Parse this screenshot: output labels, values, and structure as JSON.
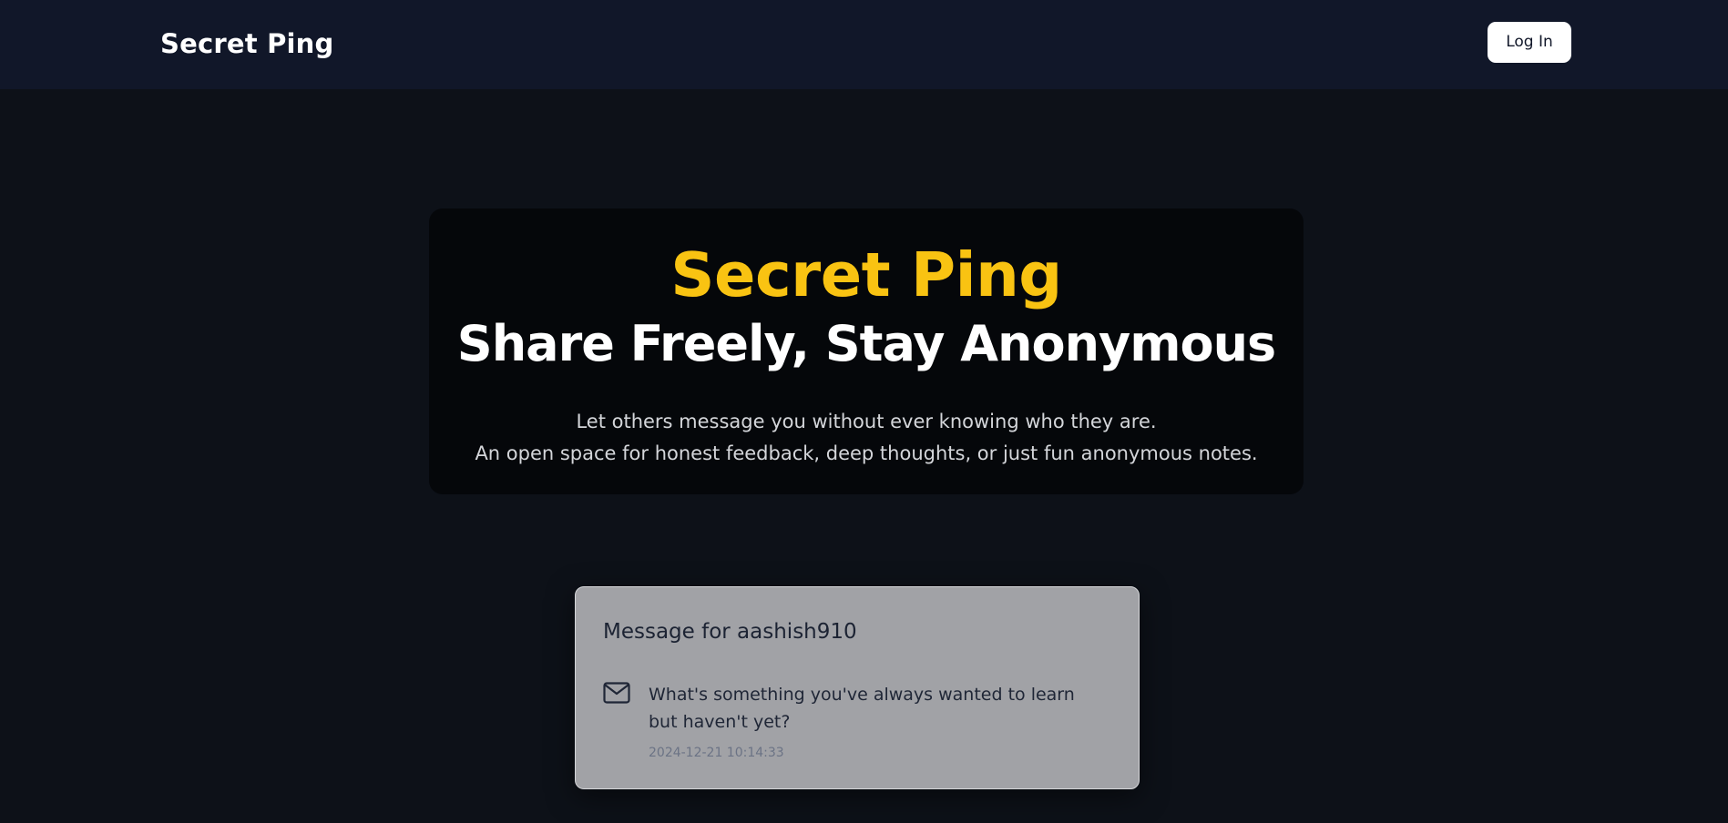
{
  "navbar": {
    "brand": "Secret Ping",
    "login_label": "Log In"
  },
  "hero": {
    "title": "Secret Ping",
    "subtitle": "Share Freely, Stay Anonymous",
    "description_lines": [
      "Let others message you without ever knowing who they are.",
      "An open space for honest feedback, deep thoughts, or just fun anonymous notes."
    ]
  },
  "message_card": {
    "title": "Message for aashish910",
    "icon": "mail-icon",
    "text": "What's something you've always wanted to learn but haven't yet?",
    "timestamp": "2024-12-21 10:14:33"
  },
  "colors": {
    "background": "#0d1118",
    "navbar": "#111729",
    "hero_panel": "#05070a",
    "accent": "#f9c312",
    "card": "#a1a2a6"
  }
}
